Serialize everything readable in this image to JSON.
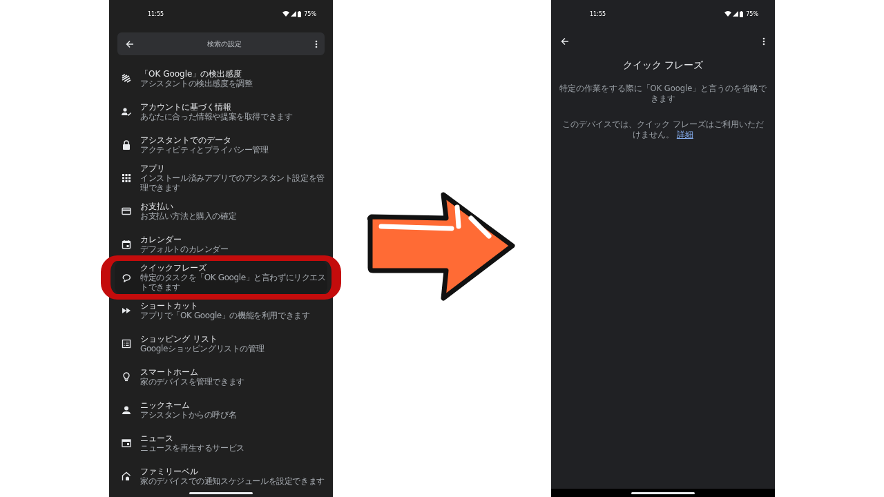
{
  "left_screen": {
    "status_bar": {
      "time": "11:55",
      "battery": "75%"
    },
    "toolbar": {
      "title": "検索の設定"
    },
    "items": [
      {
        "title": "「OK Google」の検出感度",
        "subtitle": "アシスタントの検出感度を調整",
        "highlighted": false
      },
      {
        "title": "アカウントに基づく情報",
        "subtitle": "あなたに合った情報や提案を取得できます",
        "highlighted": false
      },
      {
        "title": "アシスタントでのデータ",
        "subtitle": "アクティビティとプライバシー管理",
        "highlighted": false
      },
      {
        "title": "アプリ",
        "subtitle": "インストール済みアプリでのアシスタント設定を管理できます",
        "highlighted": false
      },
      {
        "title": "お支払い",
        "subtitle": "お支払い方法と購入の確定",
        "highlighted": false
      },
      {
        "title": "カレンダー",
        "subtitle": "デフォルトのカレンダー",
        "highlighted": false
      },
      {
        "title": "クイックフレーズ",
        "subtitle": "特定のタスクを「OK Google」と言わずにリクエストできます",
        "highlighted": true
      },
      {
        "title": "ショートカット",
        "subtitle": "アプリで「OK Google」の機能を利用できます",
        "highlighted": false
      },
      {
        "title": "ショッピング リスト",
        "subtitle": "Googleショッピングリストの管理",
        "highlighted": false
      },
      {
        "title": "スマートホーム",
        "subtitle": "家のデバイスを管理できます",
        "highlighted": false
      },
      {
        "title": "ニックネーム",
        "subtitle": "アシスタントからの呼び名",
        "highlighted": false
      },
      {
        "title": "ニュース",
        "subtitle": "ニュースを再生するサービス",
        "highlighted": false
      },
      {
        "title": "ファミリーベル",
        "subtitle": "家のデバイスでの通知スケジュールを設定できます",
        "highlighted": false
      }
    ]
  },
  "right_screen": {
    "status_bar": {
      "time": "11:55",
      "battery": "75%"
    },
    "title": "クイック フレーズ",
    "description": "特定の作業をする際に「OK Google」と言うのを省略できます",
    "notice": "このデバイスでは、クイック フレーズはご利用いただけません。",
    "link": "詳細"
  }
}
